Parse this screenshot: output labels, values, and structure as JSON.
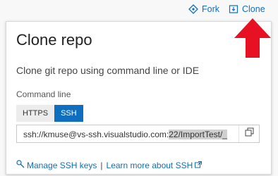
{
  "header": {
    "fork_label": "Fork",
    "clone_label": "Clone",
    "fork_icon": "fork-icon",
    "clone_icon": "clone-icon"
  },
  "clone_panel": {
    "title": "Clone repo",
    "description": "Clone git repo using command line or IDE",
    "command_line_label": "Command line",
    "tabs": [
      {
        "label": "HTTPS",
        "selected": false
      },
      {
        "label": "SSH",
        "selected": true
      }
    ],
    "url_value": "ssh://kmuse@vs-ssh.visualstudio.com:22/ImportTest/_",
    "url_unselected_part": "ssh://kmuse@vs-ssh.visualstudio.com:",
    "url_selected_part": "22/ImportTest/_",
    "copy_icon": "copy-icon",
    "links": {
      "manage_ssh": "Manage SSH keys",
      "separator": "|",
      "learn_more": "Learn more about SSH"
    }
  },
  "annotation": {
    "arrow_color": "#e81123",
    "arrow_icon": "arrow-up-icon"
  },
  "colors": {
    "accent": "#106ebe",
    "tab_inactive": "#ececec"
  }
}
